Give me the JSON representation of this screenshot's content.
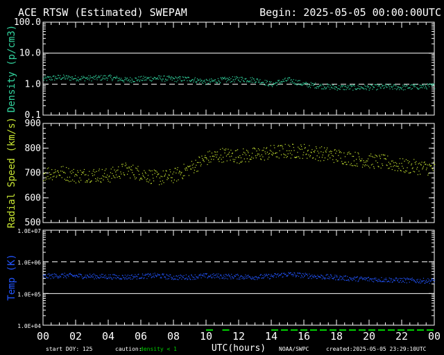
{
  "header": {
    "title": "ACE RTSW (Estimated) SWEPAM",
    "begin": "Begin: 2025-05-05 00:00:00UTC"
  },
  "footer": {
    "start_doy": "start DOY: 125",
    "caution_label": "caution:",
    "caution_value": "density < 1",
    "xlabel": "UTC(hours)",
    "credit": "NOAA/SWPC",
    "created": "created:2025-05-05 23:29:10UTC"
  },
  "colors": {
    "density": "#33d6a0",
    "speed": "#c8e632",
    "temp": "#2255ff",
    "caution": "#00d000",
    "axis": "#ffffff"
  },
  "chart_data": [
    {
      "type": "scatter",
      "name": "density",
      "ylabel": "Density (p/cm3)",
      "yscale": "log",
      "ylim": [
        0.1,
        100
      ],
      "xlim": [
        0,
        24
      ],
      "yticks": [
        "0.1",
        "1.0",
        "10.0",
        "100.0"
      ],
      "reference_lines": [
        {
          "y": 10,
          "style": "solid"
        },
        {
          "y": 1,
          "style": "dashed"
        }
      ],
      "x": [
        0,
        1,
        2,
        3,
        4,
        5,
        6,
        7,
        8,
        9,
        10,
        11,
        12,
        13,
        14,
        15,
        16,
        17,
        18,
        19,
        20,
        21,
        22,
        23,
        24
      ],
      "y": [
        1.5,
        1.7,
        1.6,
        1.6,
        1.7,
        1.4,
        1.5,
        1.6,
        1.5,
        1.5,
        1.2,
        1.4,
        1.5,
        1.4,
        1.0,
        1.4,
        1.0,
        0.9,
        0.8,
        0.8,
        0.8,
        0.85,
        0.8,
        0.85,
        0.9
      ]
    },
    {
      "type": "scatter",
      "name": "speed",
      "ylabel": "Radial Speed (km/s)",
      "ylim": [
        500,
        900
      ],
      "xlim": [
        0,
        24
      ],
      "yticks": [
        "500",
        "600",
        "700",
        "800",
        "900"
      ],
      "x": [
        0,
        1,
        2,
        3,
        4,
        5,
        6,
        7,
        8,
        9,
        10,
        11,
        12,
        13,
        14,
        15,
        16,
        17,
        18,
        19,
        20,
        21,
        22,
        23,
        24
      ],
      "y": [
        700,
        705,
        690,
        695,
        690,
        715,
        700,
        680,
        690,
        720,
        760,
        775,
        770,
        775,
        785,
        790,
        790,
        780,
        770,
        760,
        750,
        745,
        730,
        725,
        720
      ]
    },
    {
      "type": "scatter",
      "name": "temp",
      "ylabel": "Temp (K)",
      "yscale": "log",
      "ylim": [
        10000,
        10000000
      ],
      "xlim": [
        0,
        24
      ],
      "yticks": [
        "1.0E+04",
        "1.0E+05",
        "1.0E+06",
        "1.0E+07"
      ],
      "reference_lines": [
        {
          "y": 1000000,
          "style": "dashed"
        },
        {
          "y": 100000,
          "style": "solid"
        }
      ],
      "x": [
        0,
        1,
        2,
        3,
        4,
        5,
        6,
        7,
        8,
        9,
        10,
        11,
        12,
        13,
        14,
        15,
        16,
        17,
        18,
        19,
        20,
        21,
        22,
        23,
        24
      ],
      "y": [
        350000,
        380000,
        370000,
        360000,
        350000,
        340000,
        360000,
        380000,
        330000,
        340000,
        370000,
        360000,
        350000,
        340000,
        360000,
        420000,
        380000,
        350000,
        330000,
        300000,
        290000,
        280000,
        270000,
        260000,
        260000
      ]
    }
  ],
  "xaxis": {
    "ticks": [
      "00",
      "02",
      "04",
      "06",
      "08",
      "10",
      "12",
      "14",
      "16",
      "18",
      "20",
      "22",
      "00"
    ],
    "caution_segments": [
      [
        10.0,
        10.5
      ],
      [
        11.0,
        11.5
      ],
      [
        14.0,
        24.0
      ]
    ]
  }
}
